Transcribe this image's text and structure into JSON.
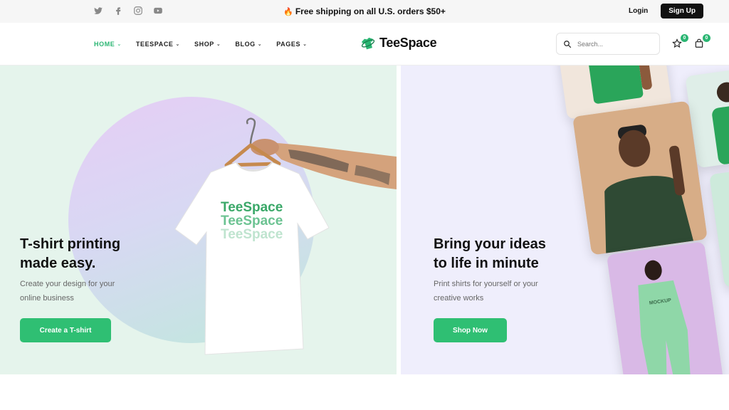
{
  "topbar": {
    "social": [
      "twitter-icon",
      "facebook-icon",
      "instagram-icon",
      "youtube-icon"
    ],
    "promo": "Free shipping on all U.S. orders $50+",
    "login": "Login",
    "signup": "Sign Up"
  },
  "nav": {
    "items": [
      {
        "label": "HOME",
        "active": true
      },
      {
        "label": "TEESPACE"
      },
      {
        "label": "SHOP"
      },
      {
        "label": "BLOG"
      },
      {
        "label": "PAGES"
      }
    ]
  },
  "brand": {
    "name": "TeeSpace",
    "accent": "#2bb673"
  },
  "search": {
    "placeholder": "Search..."
  },
  "wishlist": {
    "count": "0"
  },
  "cart": {
    "count": "0"
  },
  "hero_left": {
    "title_line1": "T-shirt printing",
    "title_line2": "made easy.",
    "sub_line1": "Create your design for your",
    "sub_line2": "online business",
    "button": "Create a T-shirt",
    "shirt_print": [
      "TeeSpace",
      "TeeSpace",
      "TeeSpace"
    ]
  },
  "hero_right": {
    "title_line1": "Bring your ideas",
    "title_line2": "to life in minute",
    "sub_line1": "Print shirts for yourself or your",
    "sub_line2": "creative works",
    "button": "Shop Now",
    "jumpsuit_print": "MOCKUP"
  },
  "colors": {
    "button": "#2fbf73",
    "left_bg": "#e5f4ec",
    "right_bg": "#efeefc"
  }
}
